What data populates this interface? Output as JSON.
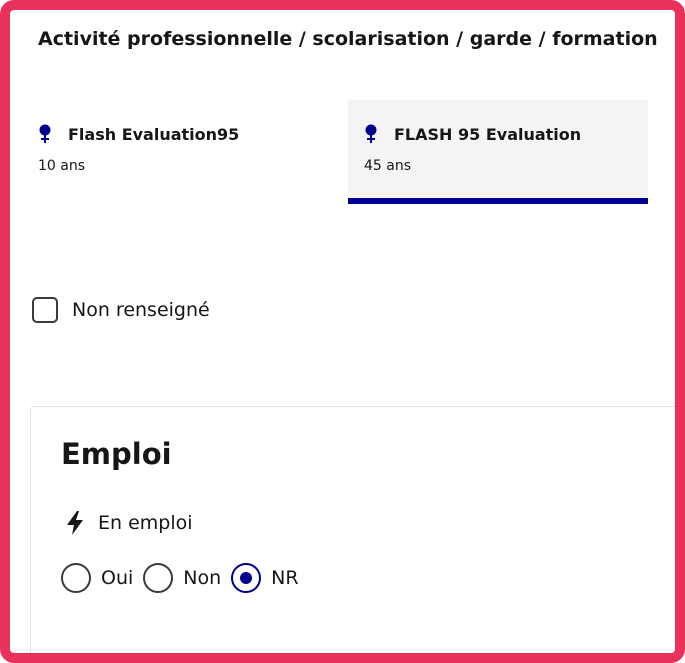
{
  "section": {
    "title": "Activité professionnelle / scolarisation / garde / formation"
  },
  "tabs": [
    {
      "name": "Flash Evaluation95",
      "age": "10 ans",
      "icon": "female-icon",
      "selected": false
    },
    {
      "name": "FLASH 95 Evaluation",
      "age": "45 ans",
      "icon": "female-icon",
      "selected": true
    }
  ],
  "non_renseigne": {
    "label": "Non renseigné",
    "checked": false
  },
  "emploi": {
    "title": "Emploi",
    "field_label": "En emploi",
    "field_icon": "bolt-icon",
    "options": [
      {
        "label": "Oui",
        "checked": false
      },
      {
        "label": "Non",
        "checked": false
      },
      {
        "label": "NR",
        "checked": true
      }
    ]
  },
  "colors": {
    "frame": "#e8325c",
    "accent": "#000091",
    "selected_tab_bg": "#f4f4f4"
  }
}
